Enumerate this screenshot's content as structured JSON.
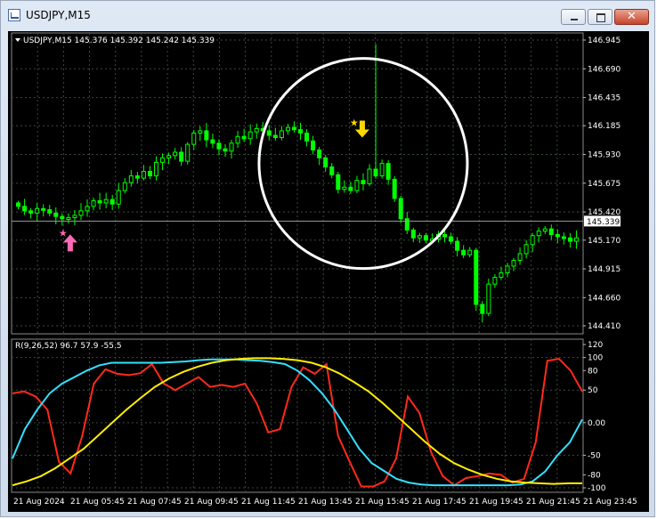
{
  "window": {
    "title": "USDJPY,M15",
    "min_icon": "minimize-icon",
    "max_icon": "maximize-icon",
    "close_icon": "close-icon",
    "close_glyph": "✕"
  },
  "chart_data": [
    {
      "type": "candlestick",
      "header": "USDJPY,M15  145.376 145.392 145.242 145.339",
      "symbol": "USDJPY,M15",
      "ohlc_header": {
        "open": 145.376,
        "high": 145.392,
        "low": 145.242,
        "close": 145.339
      },
      "y_ticks": [
        "146.945",
        "146.690",
        "146.435",
        "146.185",
        "145.930",
        "145.675",
        "145.420",
        "145.170",
        "144.915",
        "144.660",
        "144.410"
      ],
      "ylim": [
        144.41,
        146.945
      ],
      "current_price": "145.339",
      "x_ticks": [
        "21 Aug 2024",
        "21 Aug 05:45",
        "21 Aug 07:45",
        "21 Aug 09:45",
        "21 Aug 11:45",
        "21 Aug 13:45",
        "21 Aug 15:45",
        "21 Aug 17:45",
        "21 Aug 19:45",
        "21 Aug 21:45",
        "21 Aug 23:45"
      ],
      "closes": [
        145.47,
        145.43,
        145.41,
        145.45,
        145.44,
        145.41,
        145.38,
        145.36,
        145.37,
        145.39,
        145.43,
        145.47,
        145.52,
        145.5,
        145.53,
        145.49,
        145.61,
        145.68,
        145.74,
        145.72,
        145.78,
        145.74,
        145.86,
        145.9,
        145.92,
        145.95,
        145.87,
        146.02,
        146.12,
        146.14,
        146.06,
        146.03,
        145.98,
        145.96,
        146.03,
        146.09,
        146.07,
        146.13,
        146.16,
        146.14,
        146.1,
        146.08,
        146.14,
        146.17,
        146.15,
        146.12,
        146.05,
        145.97,
        145.9,
        145.82,
        145.75,
        145.62,
        145.64,
        145.61,
        145.7,
        145.67,
        145.8,
        145.74,
        145.85,
        145.71,
        145.54,
        145.36,
        145.26,
        145.19,
        145.21,
        145.17,
        145.18,
        145.22,
        145.2,
        145.16,
        145.08,
        145.04,
        145.08,
        144.6,
        144.52,
        144.78,
        144.84,
        144.88,
        144.94,
        144.99,
        145.05,
        145.13,
        145.21,
        145.25,
        145.27,
        145.22,
        145.2,
        145.19,
        145.16,
        145.19
      ],
      "trend_arrows": [
        {
          "direction": "up",
          "color": "#ff69b4"
        },
        {
          "direction": "down",
          "color": "#ffd700"
        }
      ],
      "colors": {
        "candle": "#00ff00",
        "grid": "#3b4a3b",
        "text": "#ffffff",
        "ellipse": "#ffffff"
      }
    },
    {
      "type": "line",
      "header": "R(9,26,52) 96.7 57.9 -55.5",
      "name": "R(9,26,52)",
      "readings": [
        96.7,
        57.9,
        -55.5
      ],
      "y_ticks": [
        "120",
        "100",
        "80",
        "50",
        "0.00",
        "-50",
        "-80",
        "-100"
      ],
      "ylim": [
        -100,
        120
      ],
      "series": [
        {
          "color": "#ff2a1a",
          "values": [
            45,
            48,
            40,
            20,
            -60,
            -78,
            -20,
            60,
            82,
            75,
            73,
            76,
            90,
            60,
            50,
            60,
            70,
            55,
            58,
            55,
            60,
            30,
            -15,
            -10,
            55,
            85,
            75,
            90,
            -20,
            -60,
            -98,
            -98,
            -90,
            -55,
            40,
            15,
            -45,
            -82,
            -96,
            -85,
            -82,
            -78,
            -80,
            -92,
            -86,
            -30,
            95,
            98,
            80,
            48
          ]
        },
        {
          "color": "#33e0ff",
          "values": [
            -55,
            -10,
            20,
            45,
            60,
            70,
            80,
            88,
            92,
            92,
            92,
            92,
            92,
            93,
            94,
            96,
            97,
            97,
            97,
            96,
            95,
            93,
            90,
            80,
            65,
            45,
            20,
            -10,
            -40,
            -62,
            -74,
            -86,
            -92,
            -95,
            -96,
            -96,
            -96,
            -96,
            -96,
            -96,
            -96,
            -95,
            -90,
            -75,
            -50,
            -30,
            5
          ]
        },
        {
          "color": "#ffee00",
          "values": [
            -96,
            -90,
            -82,
            -70,
            -55,
            -40,
            -20,
            0,
            20,
            38,
            55,
            68,
            78,
            86,
            92,
            96,
            98,
            99,
            99,
            98,
            96,
            92,
            85,
            75,
            62,
            48,
            30,
            10,
            -10,
            -30,
            -48,
            -62,
            -72,
            -80,
            -86,
            -90,
            -92,
            -93,
            -94,
            -93,
            -93
          ]
        }
      ]
    }
  ]
}
